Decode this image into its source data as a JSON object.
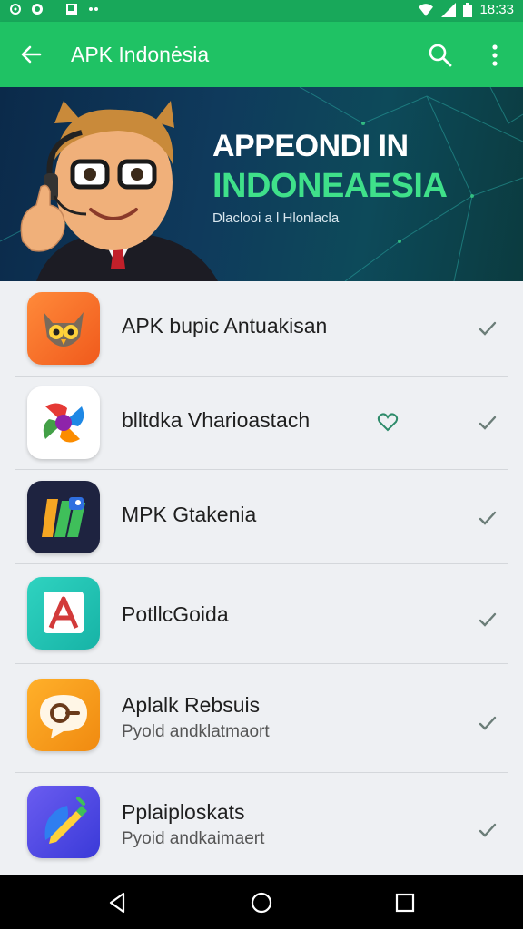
{
  "status_bar": {
    "time": "18:33",
    "icons": [
      "android-icon",
      "whatsapp-icon",
      "image-icon",
      "dots-icon",
      "wifi-icon",
      "signal-icon",
      "battery-icon"
    ]
  },
  "app_bar": {
    "title": "APK Indonėsia",
    "back_icon": "arrow-left-icon",
    "search_icon": "search-icon",
    "more_icon": "more-vert-icon",
    "color": "#1fc264"
  },
  "banner": {
    "headline_line1": "APPEONDI IN",
    "headline_line2": "INDONEAESIA",
    "subtitle": "Dlaclooi a l Hlonlacla",
    "accent": "#3fe08a"
  },
  "apps": [
    {
      "name": "APK bupic Antuakisan",
      "desc": "",
      "icon": "owl-app-icon",
      "has_heart": false
    },
    {
      "name": "blltdka Vharioastach",
      "desc": "",
      "icon": "photo-pinwheel-app-icon",
      "has_heart": true
    },
    {
      "name": "MPK Gtakenia",
      "desc": "",
      "icon": "stripes-app-icon",
      "has_heart": false
    },
    {
      "name": "PotllcGoida",
      "desc": "",
      "icon": "letter-a-app-icon",
      "has_heart": false
    },
    {
      "name": "Aplalk Rebsuis",
      "desc": "Pyold andklatmaort",
      "icon": "chat-bubble-app-icon",
      "has_heart": false
    },
    {
      "name": "Pplaiploskats",
      "desc": "Pyoid andkaimaert",
      "icon": "pencil-app-icon",
      "has_heart": false
    }
  ],
  "nav_bar": {
    "back": "nav-back-icon",
    "home": "nav-home-icon",
    "recents": "nav-recents-icon"
  }
}
